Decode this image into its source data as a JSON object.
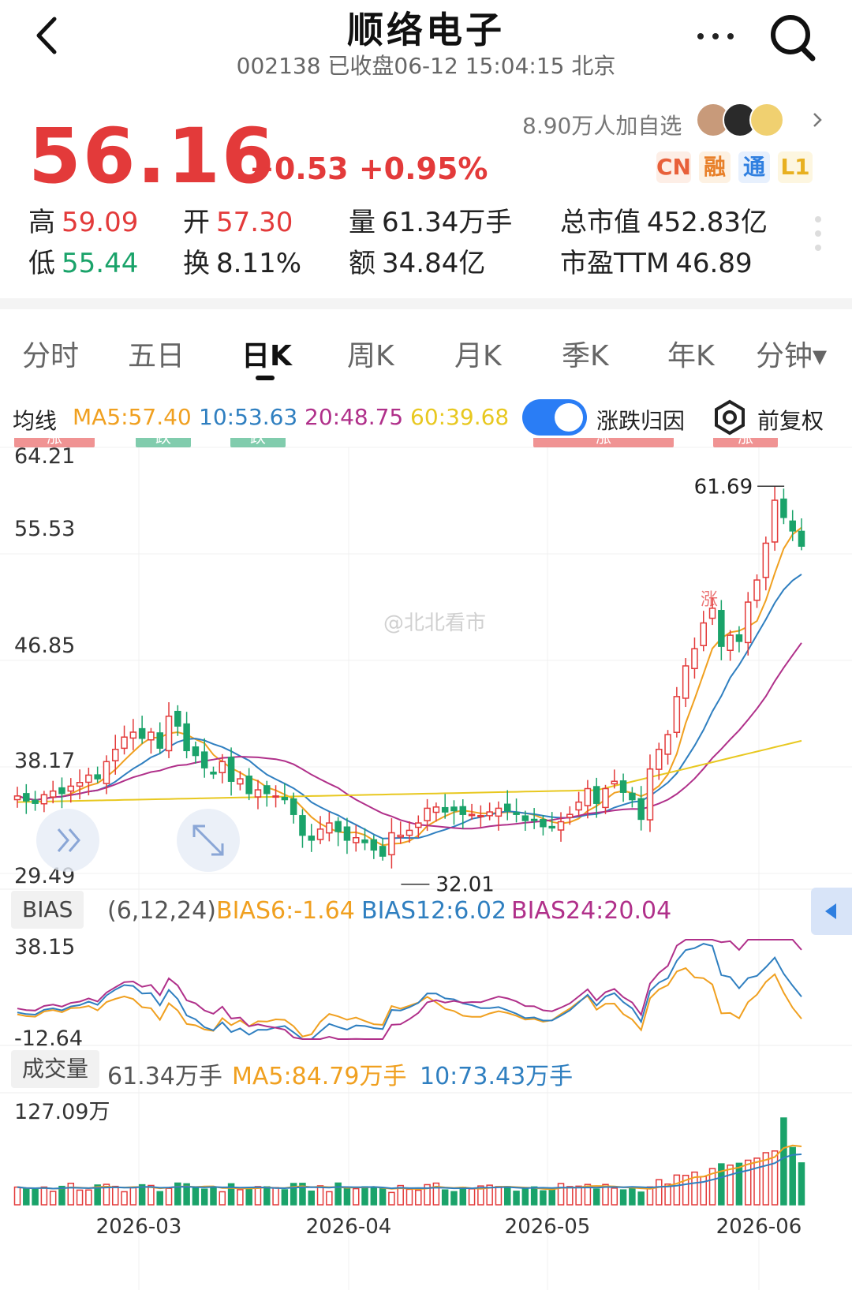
{
  "header": {
    "title": "顺络电子",
    "subtitle": "002138 已收盘06-12 15:04:15 北京"
  },
  "quote": {
    "price": "56.16",
    "change": "+0.53 +0.95%",
    "followers": "8.90万人加自选",
    "badges": [
      "CN",
      "融",
      "通",
      "L1"
    ],
    "high_label": "高",
    "high": "59.09",
    "low_label": "低",
    "low": "55.44",
    "open_label": "开",
    "open": "57.30",
    "turnover_label": "换",
    "turnover": "8.11%",
    "volume_label": "量",
    "volume": "61.34万手",
    "amount_label": "额",
    "amount": "34.84亿",
    "mcap_label": "总市值",
    "mcap": "452.83亿",
    "pe_label": "市盈TTM",
    "pe": "46.89"
  },
  "tabs": [
    "分时",
    "五日",
    "日K",
    "周K",
    "月K",
    "季K",
    "年K",
    "分钟▾"
  ],
  "active_tab": "日K",
  "ma_row": {
    "label": "均线",
    "ma5": "MA5:57.40",
    "ma10": "10:53.63",
    "ma20": "20:48.75",
    "ma60": "60:39.68",
    "toggle_label": "涨跌归因",
    "adjust_label": "前复权"
  },
  "colors": {
    "up": "#e33a3a",
    "down": "#1aa36a",
    "ma5": "#f0a020",
    "ma10": "#2f7fc0",
    "ma20": "#b0308a",
    "ma60": "#e8c820"
  },
  "kline": {
    "y_labels": [
      "64.21",
      "55.53",
      "46.85",
      "38.17",
      "29.49"
    ],
    "ylim": [
      29.49,
      64.21
    ],
    "high_marker": "61.69",
    "low_marker": "32.01",
    "event_tags": [
      "涨",
      "跌",
      "跌",
      "涨",
      "涨"
    ],
    "inline_tag": "涨",
    "watermark": "@北北看市",
    "x_labels": [
      "2026-03",
      "2026-04",
      "2026-05",
      "2026-06"
    ]
  },
  "bias": {
    "label": "BIAS",
    "params": "(6,12,24)",
    "b6": "BIAS6:-1.64",
    "b12": "BIAS12:6.02",
    "b24": "BIAS24:20.04",
    "top": "38.15",
    "bottom": "-12.64"
  },
  "volume": {
    "label": "成交量",
    "value": "61.34万手",
    "ma5": "MA5:84.79万手",
    "ma10": "10:73.43万手",
    "top": "127.09万"
  },
  "chart_data": {
    "type": "candlestick",
    "ylim": [
      29.49,
      64.21
    ],
    "x_ticks": [
      "2026-03",
      "2026-04",
      "2026-05",
      "2026-06"
    ],
    "close": [
      35.8,
      35.4,
      35.2,
      35.9,
      36.2,
      36.0,
      36.6,
      36.9,
      37.5,
      37.2,
      38.6,
      39.6,
      40.6,
      41.0,
      40.5,
      41.0,
      39.7,
      42.3,
      41.5,
      39.5,
      39.1,
      38.1,
      37.6,
      38.6,
      37.0,
      37.2,
      36.0,
      36.3,
      36.0,
      35.8,
      35.5,
      34.3,
      32.6,
      32.2,
      33.1,
      33.6,
      32.9,
      32.2,
      32.4,
      32.0,
      31.4,
      30.9,
      32.8,
      32.6,
      33.0,
      33.6,
      34.8,
      34.9,
      34.5,
      34.6,
      34.3,
      34.3,
      34.2,
      34.5,
      34.8,
      34.6,
      34.3,
      33.8,
      33.8,
      33.3,
      33.2,
      33.7,
      34.3,
      35.3,
      36.4,
      35.2,
      36.4,
      37.0,
      36.1,
      35.5,
      33.9,
      38.0,
      39.6,
      40.8,
      43.9,
      46.4,
      47.8,
      49.9,
      51.1,
      48.0,
      48.9,
      48.4,
      51.6,
      53.4,
      56.4,
      59.9,
      58.5,
      57.4,
      56.16
    ],
    "ma_latest": {
      "MA5": 57.4,
      "MA10": 53.63,
      "MA20": 48.75,
      "MA60": 39.68
    },
    "bias_latest": {
      "BIAS6": -1.64,
      "BIAS12": 6.02,
      "BIAS24": 20.04
    },
    "bias_ylim": [
      -12.64,
      38.15
    ],
    "volume_top_wan": 127.09,
    "volume_latest_wan": 61.34
  }
}
